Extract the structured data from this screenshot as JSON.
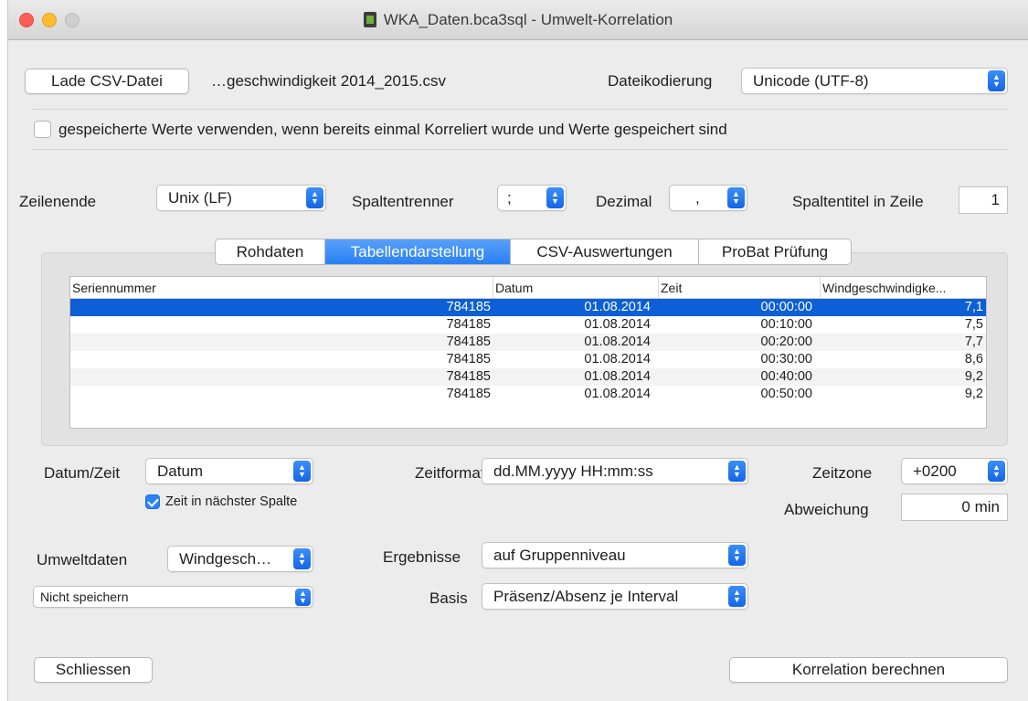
{
  "window": {
    "title": "WKA_Daten.bca3sql - Umwelt-Korrelation"
  },
  "file": {
    "load_button": "Lade CSV-Datei",
    "filename": "…geschwindigkeit 2014_2015.csv",
    "encoding_label": "Dateikodierung",
    "encoding_value": "Unicode (UTF-8)"
  },
  "use_saved": {
    "checked": false,
    "label": "gespeicherte Werte verwenden, wenn bereits einmal Korreliert wurde und Werte gespeichert sind"
  },
  "parse": {
    "line_end_label": "Zeilenende",
    "line_end_value": "Unix (LF)",
    "col_sep_label": "Spaltentrenner",
    "col_sep_value": ";",
    "decimal_label": "Dezimal",
    "decimal_value": ",",
    "header_row_label": "Spaltentitel in Zeile",
    "header_row_value": "1"
  },
  "tabs": [
    {
      "label": "Rohdaten",
      "active": false
    },
    {
      "label": "Tabellendarstellung",
      "active": true
    },
    {
      "label": "CSV-Auswertungen",
      "active": false
    },
    {
      "label": "ProBat Prüfung",
      "active": false
    }
  ],
  "table": {
    "columns": [
      "Seriennummer",
      "Datum",
      "Zeit",
      "Windgeschwindigke..."
    ],
    "rows": [
      [
        "784185",
        "01.08.2014",
        "00:00:00",
        "7,1"
      ],
      [
        "784185",
        "01.08.2014",
        "00:10:00",
        "7,5"
      ],
      [
        "784185",
        "01.08.2014",
        "00:20:00",
        "7,7"
      ],
      [
        "784185",
        "01.08.2014",
        "00:30:00",
        "8,6"
      ],
      [
        "784185",
        "01.08.2014",
        "00:40:00",
        "9,2"
      ],
      [
        "784185",
        "01.08.2014",
        "00:50:00",
        "9,2"
      ]
    ],
    "selected_row": 0
  },
  "datetime": {
    "label": "Datum/Zeit",
    "value": "Datum",
    "time_next_col_checked": true,
    "time_next_col_label": "Zeit in nächster Spalte",
    "format_label": "Zeitformat",
    "format_value": "dd.MM.yyyy HH:mm:ss",
    "timezone_label": "Zeitzone",
    "timezone_value": "+0200",
    "deviation_label": "Abweichung",
    "deviation_value": "0 min"
  },
  "env": {
    "label": "Umweltdaten",
    "value": "Windgesch…",
    "save_value": "Nicht speichern",
    "results_label": "Ergebnisse",
    "results_value": "auf Gruppenniveau",
    "basis_label": "Basis",
    "basis_value": "Präsenz/Absenz je Interval"
  },
  "actions": {
    "close_button": "Schliessen",
    "compute_button": "Korrelation berechnen"
  },
  "colors": {
    "accent": "#2a7ff5",
    "selection": "#0c5fd6",
    "close": "#fc5f57",
    "minimize": "#fdbc2e"
  }
}
